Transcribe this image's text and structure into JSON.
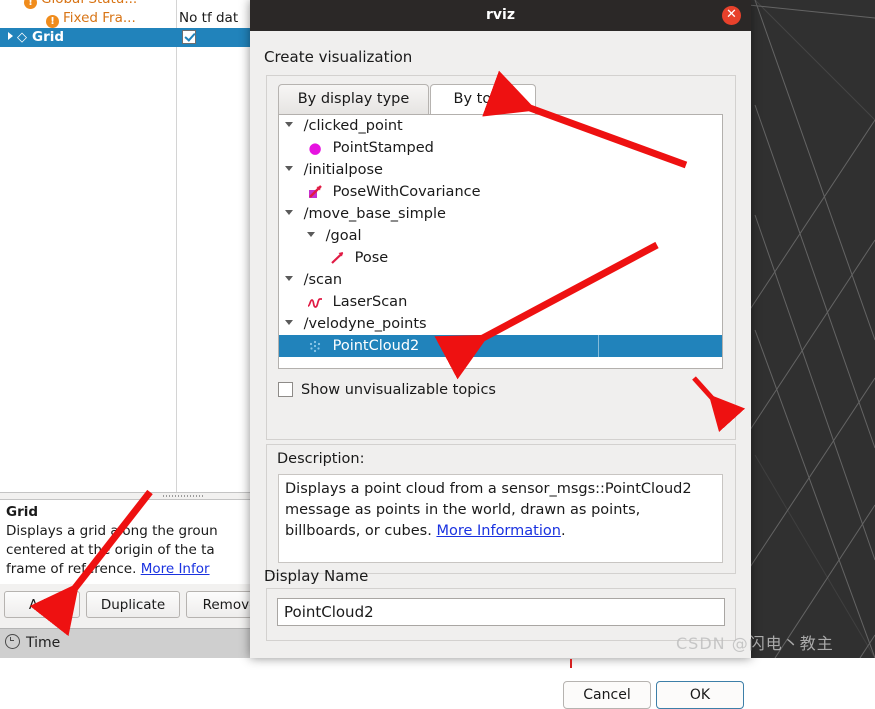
{
  "viewport": {
    "name": "rviz-3d-view",
    "background_color": "#303030",
    "grid_line_color": "#8f8f8f"
  },
  "displays_panel": {
    "tree_rows": [
      {
        "label": "Global Statu...",
        "value": "",
        "icon": "warning-icon",
        "indent": 0,
        "selected": false,
        "status": true
      },
      {
        "label": "Fixed Fra...",
        "value": "No tf dat",
        "icon": "warning-icon",
        "indent": 1,
        "selected": false,
        "status": true
      },
      {
        "label": "Grid",
        "value": "",
        "icon": "grid-icon",
        "indent": 0,
        "selected": true,
        "status": false
      }
    ],
    "help": {
      "title": "Grid",
      "body_line1": "Displays a grid along the groun",
      "body_line2": "centered at the origin of the ta",
      "body_line3": "frame of reference.",
      "link": "More Infor"
    },
    "buttons": {
      "add": "Add",
      "duplicate": "Duplicate",
      "remove": "Remove"
    },
    "time_bar": {
      "label": "Time",
      "icon": "clock-icon"
    }
  },
  "dialog": {
    "title": "rviz",
    "close_label": "✕",
    "heading": "Create visualization",
    "tabs": [
      {
        "label": "By display type",
        "active": false
      },
      {
        "label": "By topic",
        "active": true
      }
    ],
    "topic_tree": [
      {
        "label": "/clicked_point",
        "indent": 0,
        "icon": "chevron-down-icon",
        "selected": false
      },
      {
        "label": "PointStamped",
        "indent": 1,
        "icon": "pointstamped-icon",
        "selected": false
      },
      {
        "label": "/initialpose",
        "indent": 0,
        "icon": "chevron-down-icon",
        "selected": false
      },
      {
        "label": "PoseWithCovariance",
        "indent": 1,
        "icon": "posewithcovariance-icon",
        "selected": false
      },
      {
        "label": "/move_base_simple",
        "indent": 0,
        "icon": "chevron-down-icon",
        "selected": false
      },
      {
        "label": "/goal",
        "indent": 1,
        "icon": "chevron-down-icon",
        "selected": false
      },
      {
        "label": "Pose",
        "indent": 2,
        "icon": "pose-icon",
        "selected": false
      },
      {
        "label": "/scan",
        "indent": 0,
        "icon": "chevron-down-icon",
        "selected": false
      },
      {
        "label": "LaserScan",
        "indent": 1,
        "icon": "laserscan-icon",
        "selected": false
      },
      {
        "label": "/velodyne_points",
        "indent": 0,
        "icon": "chevron-down-icon",
        "selected": false
      },
      {
        "label": "PointCloud2",
        "indent": 1,
        "icon": "pointcloud2-icon",
        "selected": true
      }
    ],
    "show_unvisualizable": {
      "label": "Show unvisualizable topics",
      "checked": false
    },
    "description": {
      "label": "Description:",
      "text_before_link": "Displays a point cloud from a sensor_msgs::PointCloud2 message as points in the world, drawn as points, billboards, or cubes. ",
      "link_text": "More Information",
      "text_after_link": "."
    },
    "display_name": {
      "label": "Display Name",
      "value": "PointCloud2"
    },
    "footer_buttons": {
      "cancel": "Cancel",
      "ok": "OK"
    },
    "selection_color": "#2183bb",
    "titlebar_color": "#2b2827",
    "close_button_color": "#e8412b"
  },
  "annotations": {
    "arrow_color": "#ee1111",
    "arrows": [
      {
        "name": "arrow-to-by-topic-tab",
        "note": "points at By topic tab"
      },
      {
        "name": "arrow-to-pointcloud2-row",
        "note": "points at PointCloud2 selected row"
      },
      {
        "name": "arrow-to-description-corner",
        "note": "small arrow near bottom right of topic box"
      },
      {
        "name": "arrow-to-add-button",
        "note": "points at Add button in displays panel"
      }
    ]
  },
  "watermark": {
    "text": "CSDN @闪电丶教主"
  }
}
